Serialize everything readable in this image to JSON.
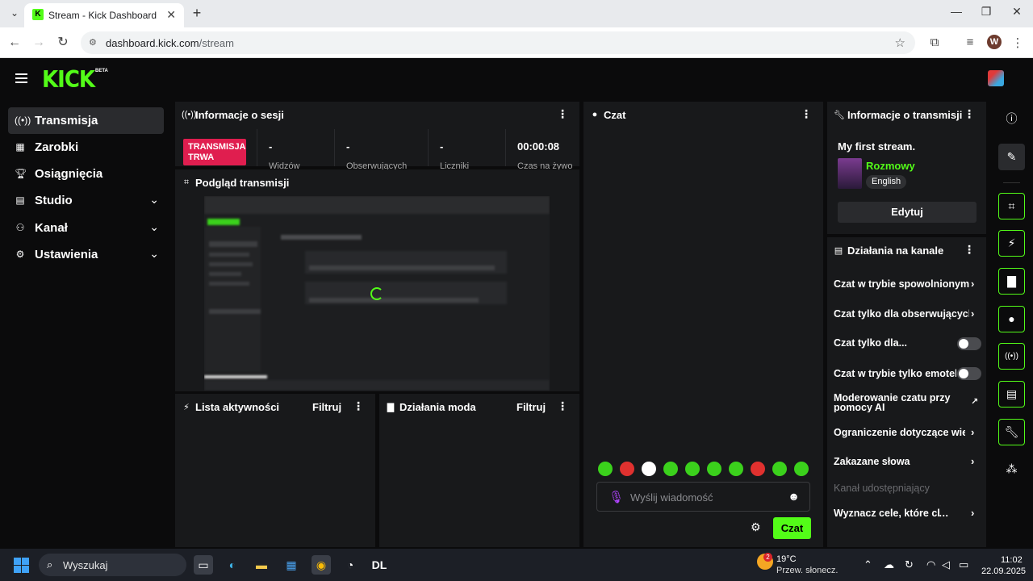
{
  "browser": {
    "tab_title": "Stream - Kick Dashboard",
    "url_host": "dashboard.kick.com",
    "url_path": "/stream",
    "profile_initial": "W"
  },
  "app": {
    "logo": "KICK",
    "logo_badge": "BETA"
  },
  "sidebar": {
    "items": [
      {
        "label": "Transmisja",
        "icon": "broadcast-icon",
        "active": true
      },
      {
        "label": "Zarobki",
        "icon": "chart-icon"
      },
      {
        "label": "Osiągnięcia",
        "icon": "trophy-icon"
      },
      {
        "label": "Studio",
        "icon": "studio-icon",
        "expandable": true
      },
      {
        "label": "Kanał",
        "icon": "channel-icon",
        "expandable": true
      },
      {
        "label": "Ustawienia",
        "icon": "gear-icon",
        "expandable": true
      }
    ]
  },
  "session": {
    "title": "Informacje o sesji",
    "live_badge": "TRANSMISJA TRWA",
    "stats": [
      {
        "value": "-",
        "label": "Widzów"
      },
      {
        "value": "-",
        "label": "Obserwujących"
      },
      {
        "value": "-",
        "label": "Liczniki"
      },
      {
        "value": "00:00:08",
        "label": "Czas na żywo"
      }
    ]
  },
  "preview": {
    "title": "Podgląd transmisji"
  },
  "activity": {
    "title": "Lista aktywności",
    "filter": "Filtruj"
  },
  "mod_actions": {
    "title": "Działania moda",
    "filter": "Filtruj"
  },
  "chat": {
    "title": "Czat",
    "placeholder": "Wyślij wiadomość",
    "send": "Czat",
    "emote_colors": [
      "#3bd11c",
      "#e0312f",
      "#ffffff",
      "#3bd11c",
      "#3bd11c",
      "#3bd11c",
      "#3bd11c",
      "#e0312f",
      "#3bd11c",
      "#3bd11c"
    ]
  },
  "stream_info": {
    "title": "Informacje o transmisji",
    "stream_title": "My first stream.",
    "category": "Rozmowy",
    "language": "English",
    "edit": "Edytuj"
  },
  "channel_actions": {
    "title": "Działania na kanale",
    "items": [
      {
        "label": "Czat w trybie spowolnionym",
        "type": "chevron"
      },
      {
        "label": "Czat tylko dla obserwujących",
        "type": "chevron"
      },
      {
        "label": "Czat tylko dla...",
        "type": "toggle"
      },
      {
        "label": "Czat w trybie tylko emotek",
        "type": "toggle"
      },
      {
        "label": "Moderowanie czatu przy pomocy AI",
        "type": "external"
      },
      {
        "label": "Ograniczenie dotyczące wieku",
        "type": "chevron"
      },
      {
        "label": "Zakazane słowa",
        "type": "chevron"
      },
      {
        "label": "Kanał udostępniający",
        "type": "disabled"
      },
      {
        "label": "Wyznacz cele, które chcesz osiągnąć",
        "type": "chevron"
      }
    ]
  },
  "taskbar": {
    "search": "Wyszukaj",
    "temp": "19°C",
    "weather": "Przew. słonecz.",
    "weather_badge": "2",
    "time": "11:02",
    "date": "22.09.2025"
  }
}
